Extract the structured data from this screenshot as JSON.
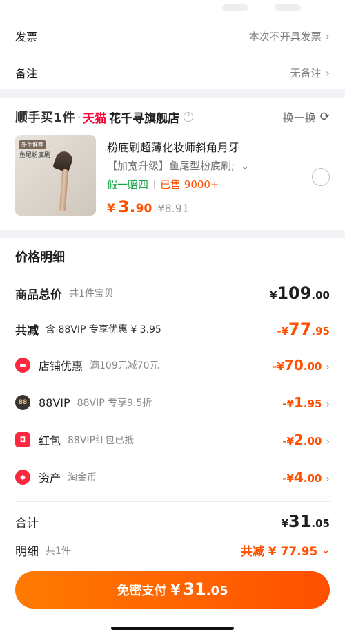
{
  "invoice": {
    "label": "发票",
    "value": "本次不开具发票"
  },
  "remark": {
    "label": "备注",
    "value": "无备注"
  },
  "shop": {
    "brand_prefix": "顺手买1件",
    "platform": "天猫",
    "name": "花千寻旗舰店",
    "swap_label": "换一换"
  },
  "product": {
    "image_tag": "新手推荐",
    "image_caption": "鱼尾粉底刷",
    "title": "粉底刷超薄化妆师斜角月牙",
    "spec": "【加宽升级】鱼尾型粉底刷;",
    "tag_guarantee": "假一赔四",
    "tag_sold": "已售 9000+",
    "price_symbol": "¥",
    "price_int": "3.",
    "price_dec": "90",
    "original_price": "¥8.91"
  },
  "price_detail": {
    "title": "价格明细",
    "goods_total": {
      "label": "商品总价",
      "sub": "共1件宝贝",
      "symbol": "¥",
      "int": "109",
      "dec": ".00"
    },
    "total_discount": {
      "label": "共减",
      "sub": "含 88VIP 专享优惠 ¥ 3.95",
      "symbol": "-¥",
      "int": "77",
      "dec": ".95"
    },
    "shop_discount": {
      "label": "店铺优惠",
      "sub": "满109元减70元",
      "symbol": "-¥",
      "int": "70",
      "dec": ".00"
    },
    "vip": {
      "label": "88VIP",
      "icon": "88",
      "sub": "88VIP 专享9.5折",
      "symbol": "-¥",
      "int": "1",
      "dec": ".95"
    },
    "red_packet": {
      "label": "红包",
      "sub": "88VIP红包已抵",
      "symbol": "-¥",
      "int": "2",
      "dec": ".00"
    },
    "assets": {
      "label": "资产",
      "sub": "淘金币",
      "symbol": "-¥",
      "int": "4",
      "dec": ".00"
    }
  },
  "summary": {
    "total_label": "合计",
    "total_symbol": "¥",
    "total_int": "31",
    "total_dec": ".05",
    "detail_label": "明细",
    "detail_count": "共1件",
    "detail_discount": "共减 ¥ 77.95"
  },
  "pay_button": {
    "label": "免密支付",
    "symbol": "¥",
    "int": "31",
    "dec": ".05"
  },
  "colors": {
    "accent": "#ff5000",
    "tmall_red": "#ff0036",
    "green": "#1aa34a"
  }
}
